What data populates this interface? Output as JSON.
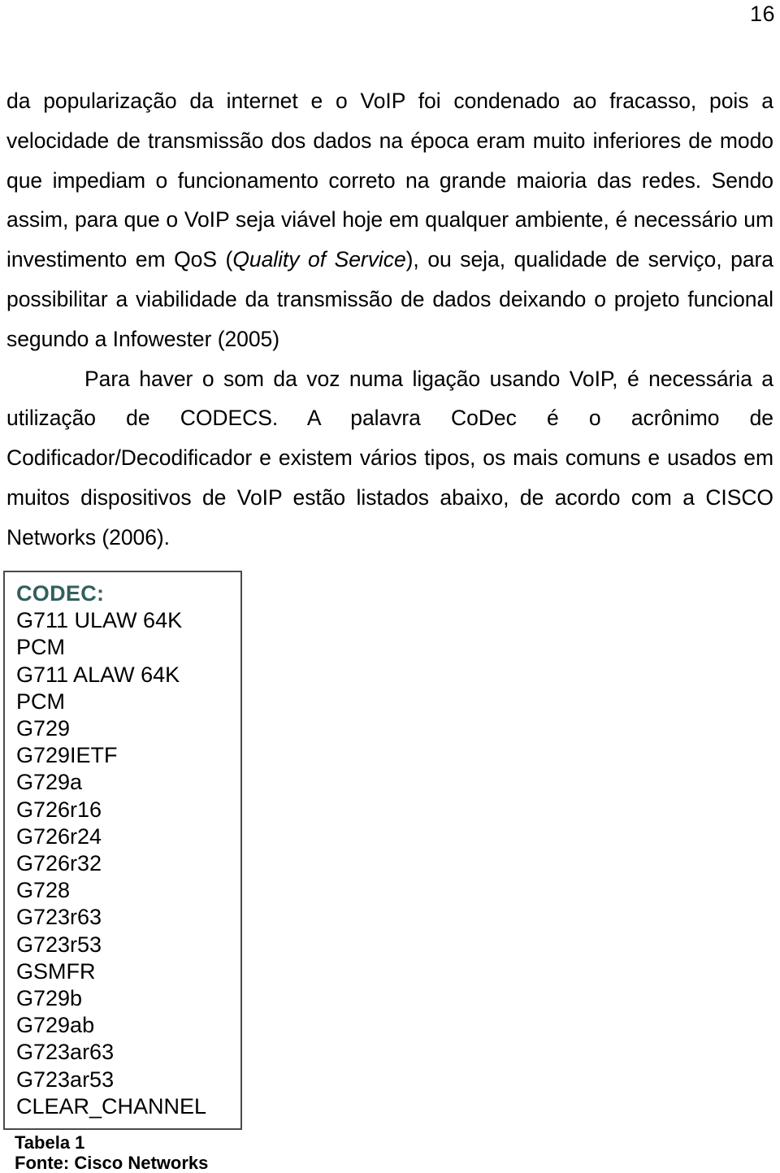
{
  "page": {
    "number": "16"
  },
  "body": {
    "paragraphs": [
      {
        "id": "p1",
        "indent": false,
        "runs": [
          {
            "text": "da popularização da internet e o VoIP foi condenado ao fracasso, pois a velocidade de transmissão dos dados na época eram muito inferiores de modo que impediam o funcionamento correto na grande maioria das redes. Sendo assim, para que o VoIP seja viável hoje em qualquer ambiente, é necessário um investimento em QoS (",
            "style": "normal"
          },
          {
            "text": "Quality of Service",
            "style": "italic"
          },
          {
            "text": "), ou seja, qualidade de serviço, para possibilitar a viabilidade da transmissão de dados deixando o projeto funcional segundo a Infowester (2005)",
            "style": "normal"
          }
        ],
        "plain": "da popularização da internet e o VoIP foi condenado ao fracasso, pois a velocidade de transmissão dos dados na época eram muito inferiores de modo que impediam o funcionamento correto na grande maioria das redes. Sendo assim, para que o VoIP seja viável hoje em qualquer ambiente, é necessário um investimento em QoS (Quality of Service), ou seja, qualidade de serviço, para possibilitar a viabilidade da transmissão de dados deixando o projeto funcional segundo a Infowester (2005)"
      },
      {
        "id": "p2",
        "indent": true,
        "plain": "Para haver o som da voz numa ligação usando VoIP, é necessária a utilização de CODECS. A palavra CoDec é o acrônimo de Codificador/Decodificador e existem vários tipos, os mais comuns e usados em muitos dispositivos de VoIP estão listados abaixo, de acordo com a CISCO Networks (2006)."
      }
    ]
  },
  "codec_table": {
    "heading": "CODEC:",
    "heading_color": "#31605e",
    "border_color": "#4a4a4a",
    "items": [
      "G711 ULAW 64K",
      "PCM",
      "G711 ALAW 64K",
      "PCM",
      "G729",
      "G729IETF",
      "G729a",
      "G726r16",
      "G726r24",
      "G726r32",
      "G728",
      "G723r63",
      "G723r53",
      "GSMFR",
      "G729b",
      "G729ab",
      "G723ar63",
      "G723ar53",
      "CLEAR_CHANNEL"
    ]
  },
  "caption": {
    "label": "Tabela 1",
    "source": "Fonte: Cisco Networks"
  }
}
